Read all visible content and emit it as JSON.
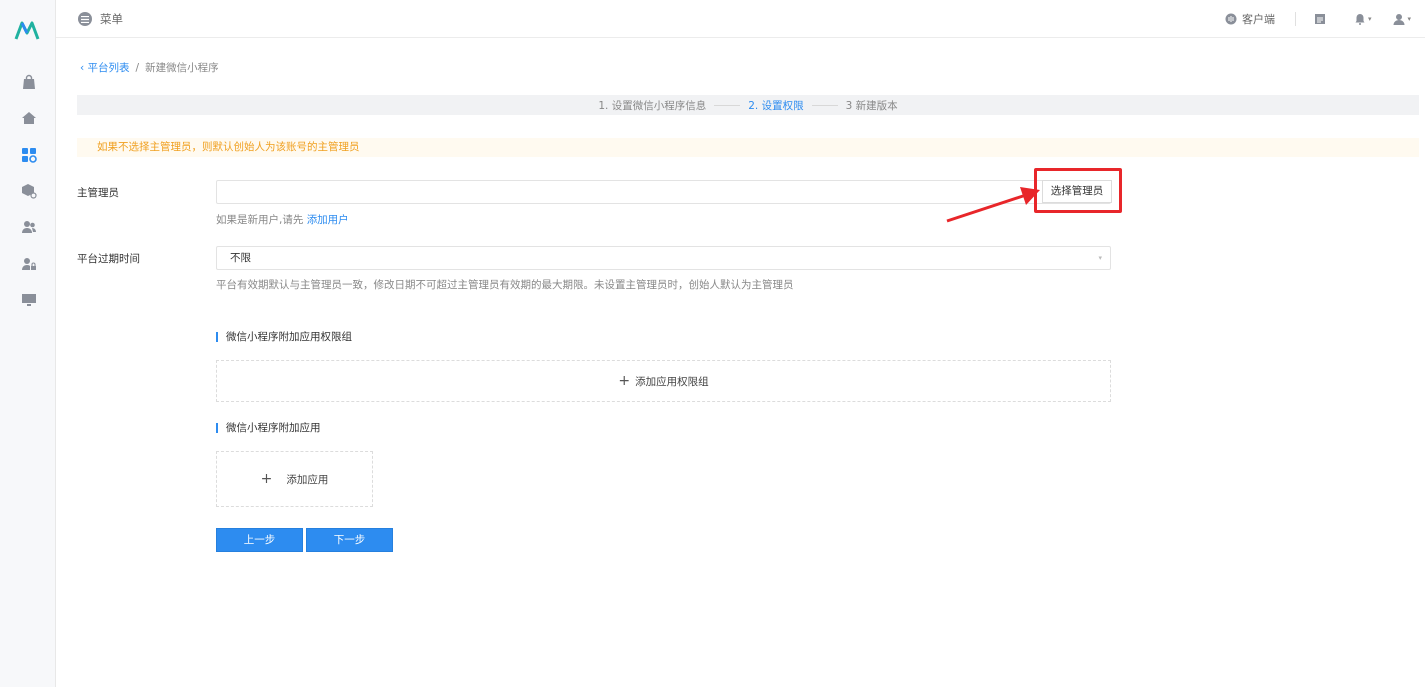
{
  "topbar": {
    "menu_label": "菜单",
    "client_label": "客户端"
  },
  "breadcrumb": {
    "back": "平台列表",
    "separator": "/",
    "current": "新建微信小程序"
  },
  "steps": [
    {
      "label": "1. 设置微信小程序信息"
    },
    {
      "label": "2. 设置权限"
    },
    {
      "label": "3 新建版本"
    }
  ],
  "alert": {
    "text": "如果不选择主管理员，则默认创始人为该账号的主管理员"
  },
  "form": {
    "admin_label": "主管理员",
    "admin_value": "",
    "select_admin_button": "选择管理员",
    "admin_help_prefix": "如果是新用户,请先",
    "admin_help_link": "添加用户",
    "expire_label": "平台过期时间",
    "expire_value": "不限",
    "expire_help": "平台有效期默认与主管理员一致，修改日期不可超过主管理员有效期的最大期限。未设置主管理员时，创始人默认为主管理员"
  },
  "sections": {
    "perm_group_title": "微信小程序附加应用权限组",
    "add_perm_group": "添加应用权限组",
    "apps_title": "微信小程序附加应用",
    "add_app": "添加应用"
  },
  "buttons": {
    "prev": "上一步",
    "next": "下一步"
  },
  "colors": {
    "primary": "#2d8cf0",
    "warning": "#f0a020",
    "highlight": "#e8262a"
  }
}
